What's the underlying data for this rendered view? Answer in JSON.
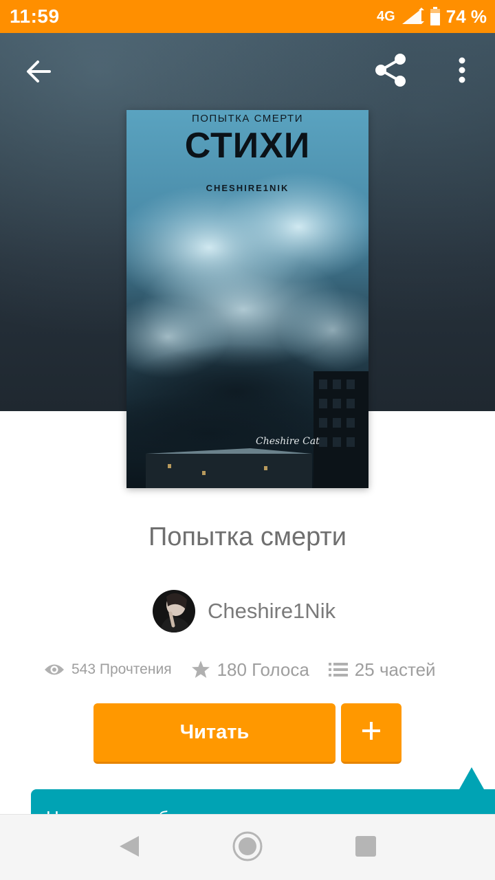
{
  "status_bar": {
    "time": "11:59",
    "network": "4G",
    "battery_percent": "74 %",
    "battery_level": 0.74,
    "icons": [
      "signal-icon",
      "battery-icon"
    ]
  },
  "toolbar": {
    "icons": [
      "back-arrow-icon",
      "share-icon",
      "more-vertical-icon"
    ]
  },
  "cover": {
    "subtitle": "ПОПЫТКА СМЕРТИ",
    "title": "СТИХИ",
    "author": "CHESHIRE1NIK",
    "signature": "Cheshire Cat"
  },
  "story": {
    "title": "Попытка смерти",
    "author": "Cheshire1Nik",
    "reads": "543 Прочтения",
    "votes": "180 Голоса",
    "parts": "25 частей"
  },
  "actions": {
    "read_label": "Читать",
    "add_icon": "plus-icon"
  },
  "tooltip": {
    "text": "Нажмите, чтобы сохранить эту историю на"
  },
  "nav_bar": {
    "icons": [
      "nav-back-icon",
      "nav-home-icon",
      "nav-recents-icon"
    ]
  },
  "colors": {
    "status_bar": "#ff8f00",
    "accent": "#ff9800",
    "tooltip": "#00a3b4",
    "muted_text": "#9e9e9e"
  }
}
